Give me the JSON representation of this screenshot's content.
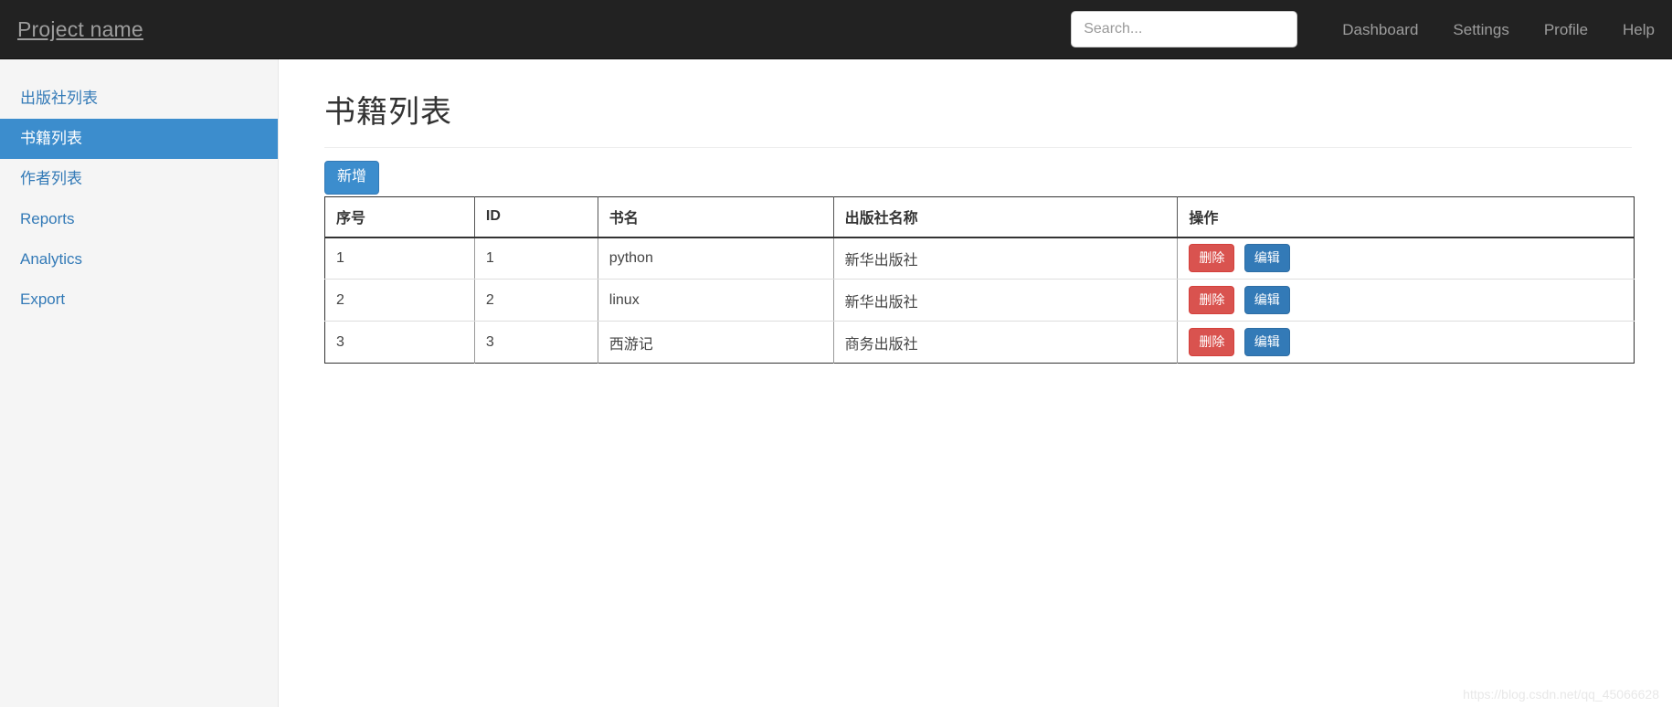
{
  "navbar": {
    "brand": "Project name",
    "search": {
      "placeholder": "Search...",
      "value": ""
    },
    "links": [
      {
        "label": "Dashboard"
      },
      {
        "label": "Settings"
      },
      {
        "label": "Profile"
      },
      {
        "label": "Help"
      }
    ]
  },
  "sidebar": {
    "items": [
      {
        "label": "出版社列表",
        "active": false
      },
      {
        "label": "书籍列表",
        "active": true
      },
      {
        "label": "作者列表",
        "active": false
      },
      {
        "label": "Reports",
        "active": false
      },
      {
        "label": "Analytics",
        "active": false
      },
      {
        "label": "Export",
        "active": false
      }
    ]
  },
  "main": {
    "title": "书籍列表",
    "add_button": "新增",
    "table": {
      "columns": [
        "序号",
        "ID",
        "书名",
        "出版社名称",
        "操作"
      ],
      "rows": [
        {
          "index": "1",
          "id": "1",
          "book_name": "python",
          "publisher": "新华出版社",
          "delete_label": "删除",
          "edit_label": "编辑"
        },
        {
          "index": "2",
          "id": "2",
          "book_name": "linux",
          "publisher": "新华出版社",
          "delete_label": "删除",
          "edit_label": "编辑"
        },
        {
          "index": "3",
          "id": "3",
          "book_name": "西游记",
          "publisher": "商务出版社",
          "delete_label": "删除",
          "edit_label": "编辑"
        }
      ]
    }
  },
  "watermark": "https://blog.csdn.net/qq_45066628",
  "colors": {
    "navbar_bg": "#222222",
    "nav_text": "#9d9d9d",
    "sidebar_bg": "#f5f5f5",
    "sidebar_link": "#337ab7",
    "active_bg": "#3c8dcd",
    "add_button_bg": "#3c8dcd",
    "danger": "#d9534f",
    "primary": "#337ab7"
  }
}
